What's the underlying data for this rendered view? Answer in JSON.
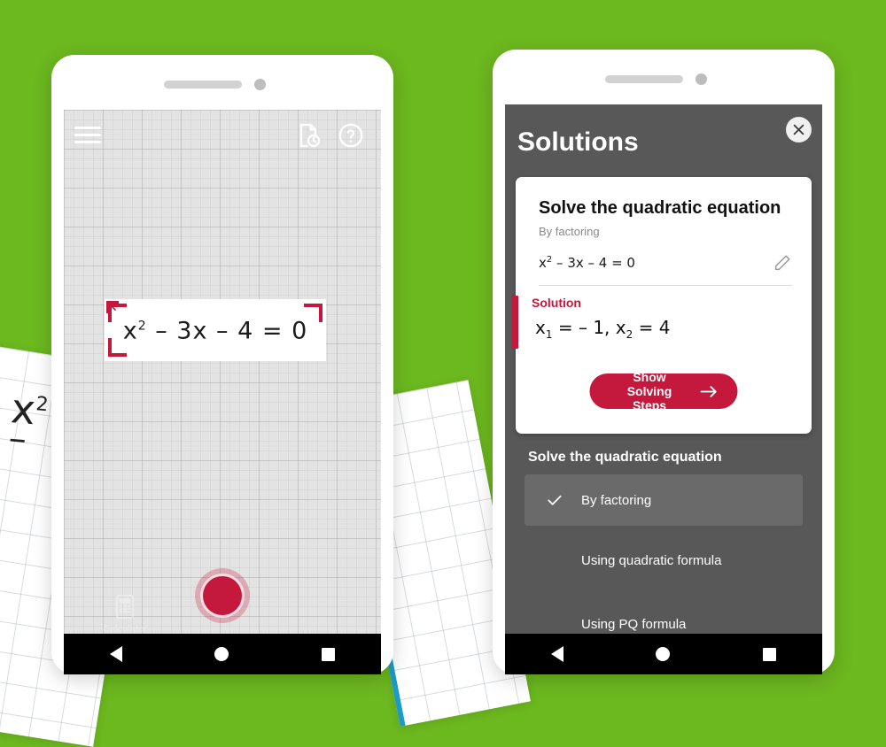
{
  "theme": {
    "background_green": "#6CB81F",
    "accent_red": "#C4193C",
    "panel_gray": "#585858",
    "selected_gray": "#6A6A6A",
    "paper_edge_blue": "#1E9BC4"
  },
  "background": {
    "scrap_left_text": "x",
    "scrap_left_sup": "2"
  },
  "left_phone": {
    "toolbar": {
      "menu_icon": "hamburger-menu-icon",
      "history_icon": "history-document-icon",
      "help_icon": "help-question-icon"
    },
    "capture": {
      "equation_base": "x",
      "equation_sup": "2",
      "equation_rest": "– 3x – 4 = 0",
      "corner_marker": "crop-corner-marker",
      "resize_handle": "resize-handle-icon"
    },
    "shutter": {
      "label": "capture-shutter-button"
    },
    "shortcut": {
      "label": "Calculator",
      "icon": "calculator-icon"
    },
    "navbar": {
      "back": "back-triangle-icon",
      "home": "home-circle-icon",
      "recents": "recents-square-icon"
    }
  },
  "right_phone": {
    "header": {
      "title": "Solutions",
      "close_icon": "close-x-icon"
    },
    "card": {
      "title": "Solve the quadratic equation",
      "subtitle": "By factoring",
      "equation_base": "x",
      "equation_sup": "2",
      "equation_rest": "– 3x – 4 = 0",
      "edit_icon": "pencil-edit-icon",
      "solution_label": "Solution",
      "root1_var": "x",
      "root1_sub": "1",
      "root1_eq": "= – 1",
      "separator": ",",
      "root2_var": "x",
      "root2_sub": "2",
      "root2_eq": "= 4",
      "steps_button": "Show Solving Steps",
      "steps_arrow": "arrow-right-icon"
    },
    "methods": {
      "section_title": "Solve the quadratic equation",
      "items": [
        {
          "label": "By factoring",
          "selected": true,
          "check_icon": "check-icon"
        },
        {
          "label": "Using quadratic formula",
          "selected": false
        },
        {
          "label": "Using PQ formula",
          "selected": false
        }
      ]
    },
    "navbar": {
      "back": "back-triangle-icon",
      "home": "home-circle-icon",
      "recents": "recents-square-icon"
    }
  }
}
